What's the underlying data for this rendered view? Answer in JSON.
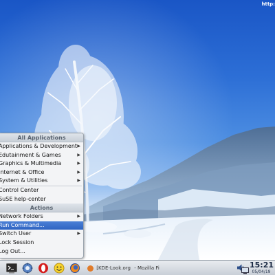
{
  "desktop": {
    "url_label": "http:",
    "wallpaper": "winter-birch-tree-snow"
  },
  "kmenu": {
    "title_all": "All Applications",
    "apps": [
      {
        "label": "Applications & Development",
        "submenu": true
      },
      {
        "label": "Edutainment & Games",
        "submenu": true
      },
      {
        "label": "Graphics & Multimedia",
        "submenu": true
      },
      {
        "label": "Internet & Office",
        "submenu": true
      },
      {
        "label": "System & Utilities",
        "submenu": true
      }
    ],
    "control_center": "Control Center",
    "help_center": "SuSE help-center",
    "title_actions": "Actions",
    "actions": [
      {
        "label": "Network Folders",
        "submenu": true
      },
      {
        "label": "Run Command...",
        "submenu": false,
        "highlight": true
      },
      {
        "label": "Switch User",
        "submenu": true
      },
      {
        "label": "Lock Session",
        "submenu": false
      },
      {
        "label": "Log Out...",
        "submenu": false
      }
    ]
  },
  "taskbar": {
    "task_button_1": "[KDE-Look.org",
    "task_button_2": "- Mozilla Fi",
    "clock_time": "15:21",
    "clock_date": "05/04/19",
    "colors": {
      "accent": "#2f64c2",
      "panel": "#d6dbe1"
    }
  }
}
